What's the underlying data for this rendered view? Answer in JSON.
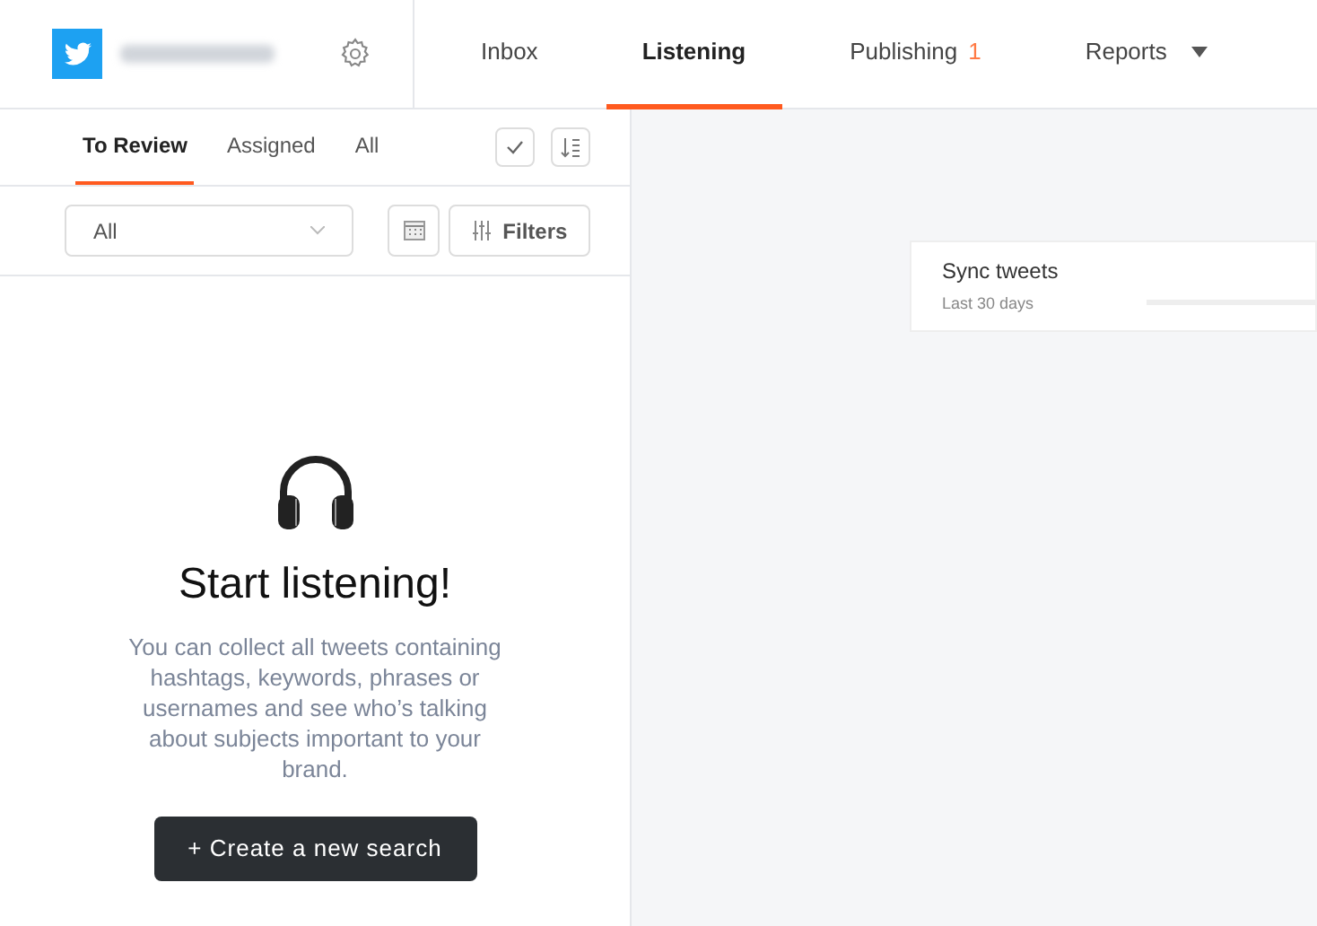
{
  "nav_tabs": [
    {
      "label": "Inbox",
      "selected": false
    },
    {
      "label": "Listening",
      "selected": true
    },
    {
      "label": "Publishing",
      "badge": "1",
      "selected": false
    },
    {
      "label": "Reports",
      "dropdown": true,
      "selected": false
    }
  ],
  "sub_tabs": [
    {
      "label": "To Review",
      "selected": true
    },
    {
      "label": "Assigned",
      "selected": false
    },
    {
      "label": "All",
      "selected": false
    }
  ],
  "filter_select": {
    "value": "All"
  },
  "filters_button": "Filters",
  "empty_state": {
    "title": "Start listening!",
    "description": "You can collect all tweets containing hashtags, keywords, phrases or usernames and see who’s talking about subjects important to your brand.",
    "button": "+ Create a new search"
  },
  "sync_card": {
    "title": "Sync tweets",
    "subtitle": "Last 30 days"
  }
}
